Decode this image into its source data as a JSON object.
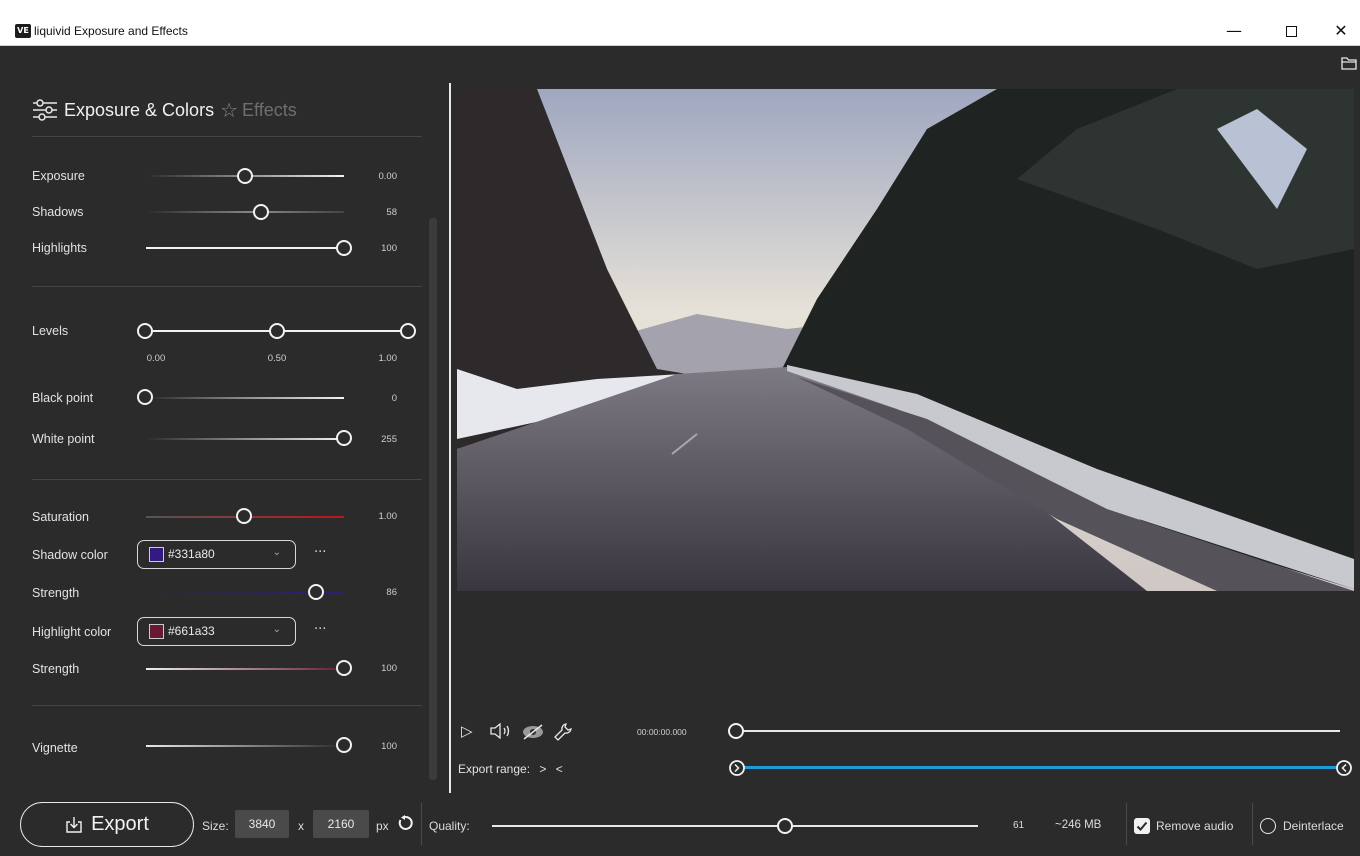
{
  "window": {
    "app_icon_text": "VE",
    "title": "liquivid Exposure and Effects",
    "minimize": "—",
    "close": "✕"
  },
  "panel": {
    "tab_exposure": "Exposure & Colors",
    "tab_effects": "Effects",
    "controls": {
      "exposure": {
        "label": "Exposure",
        "value": "0.00",
        "level": 0.5
      },
      "shadows": {
        "label": "Shadows",
        "value": "58",
        "level": 0.58
      },
      "highlights": {
        "label": "Highlights",
        "value": "100",
        "level": 1.0
      },
      "levels": {
        "label": "Levels",
        "low": "0.00",
        "mid": "0.50",
        "high": "1.00"
      },
      "black_point": {
        "label": "Black point",
        "value": "0",
        "level": 0.0
      },
      "white_point": {
        "label": "White point",
        "value": "255",
        "level": 1.0
      },
      "saturation": {
        "label": "Saturation",
        "value": "1.00",
        "level": 0.5
      },
      "shadow_color": {
        "label": "Shadow color",
        "value": "#331a80",
        "swatch": "#331a80"
      },
      "shadow_strength": {
        "label": "Strength",
        "value": "86",
        "level": 0.86
      },
      "highlight_color": {
        "label": "Highlight color",
        "value": "#661a33",
        "swatch": "#661a33"
      },
      "highlight_strength": {
        "label": "Strength",
        "value": "100",
        "level": 1.0
      },
      "vignette": {
        "label": "Vignette",
        "value": "100",
        "level": 1.0
      }
    },
    "more_label": "···"
  },
  "player": {
    "timecode": "00:00:00.000",
    "export_range_label": "Export range:",
    "range_start_glyph": ">",
    "range_end_glyph": "<"
  },
  "bottom": {
    "export_label": "Export",
    "size_label": "Size:",
    "width": "3840",
    "x_label": "x",
    "height": "2160",
    "px_label": "px",
    "quality_label": "Quality:",
    "quality_value": "61",
    "quality_level": 0.61,
    "file_size": "~246 MB",
    "remove_audio_label": "Remove audio",
    "remove_audio_checked": true,
    "deinterlace_label": "Deinterlace",
    "deinterlace_checked": false
  },
  "colors": {
    "accent": "#1e9ad6",
    "saturation_track": "#c0141a",
    "background": "#2b2b2b"
  }
}
